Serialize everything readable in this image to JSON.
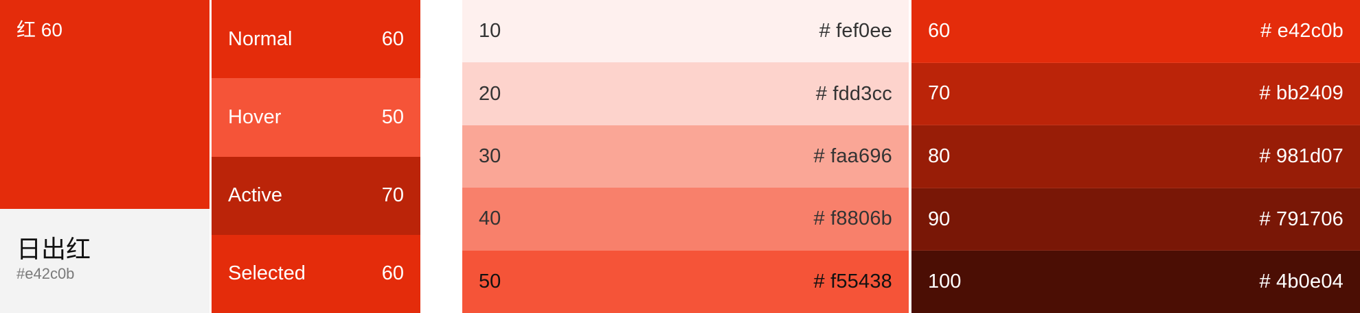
{
  "primary": {
    "tag": "红 60",
    "name": "日出红",
    "hex": "#e42c0b",
    "color": "#e42c0b",
    "info_bg": "#f3f3f3"
  },
  "states": [
    {
      "label": "Normal",
      "value": "60",
      "color": "#e42c0b"
    },
    {
      "label": "Hover",
      "value": "50",
      "color": "#f55438"
    },
    {
      "label": "Active",
      "value": "70",
      "color": "#bb2409"
    },
    {
      "label": "Selected",
      "value": "60",
      "color": "#e42c0b"
    }
  ],
  "scale_light": [
    {
      "step": "10",
      "hex": "# fef0ee",
      "color": "#fef0ee",
      "text": "dark"
    },
    {
      "step": "20",
      "hex": "# fdd3cc",
      "color": "#fdd3cc",
      "text": "dark"
    },
    {
      "step": "30",
      "hex": "# faa696",
      "color": "#faa696",
      "text": "dark"
    },
    {
      "step": "40",
      "hex": "# f8806b",
      "color": "#f8806b",
      "text": "dark"
    },
    {
      "step": "50",
      "hex": "# f55438",
      "color": "#f55438",
      "text": "black"
    }
  ],
  "scale_dark": [
    {
      "step": "60",
      "hex": "# e42c0b",
      "color": "#e42c0b",
      "text": "white"
    },
    {
      "step": "70",
      "hex": "# bb2409",
      "color": "#bb2409",
      "text": "white"
    },
    {
      "step": "80",
      "hex": "# 981d07",
      "color": "#981d07",
      "text": "white"
    },
    {
      "step": "90",
      "hex": "# 791706",
      "color": "#791706",
      "text": "white"
    },
    {
      "step": "100",
      "hex": "# 4b0e04",
      "color": "#4b0e04",
      "text": "white"
    }
  ]
}
